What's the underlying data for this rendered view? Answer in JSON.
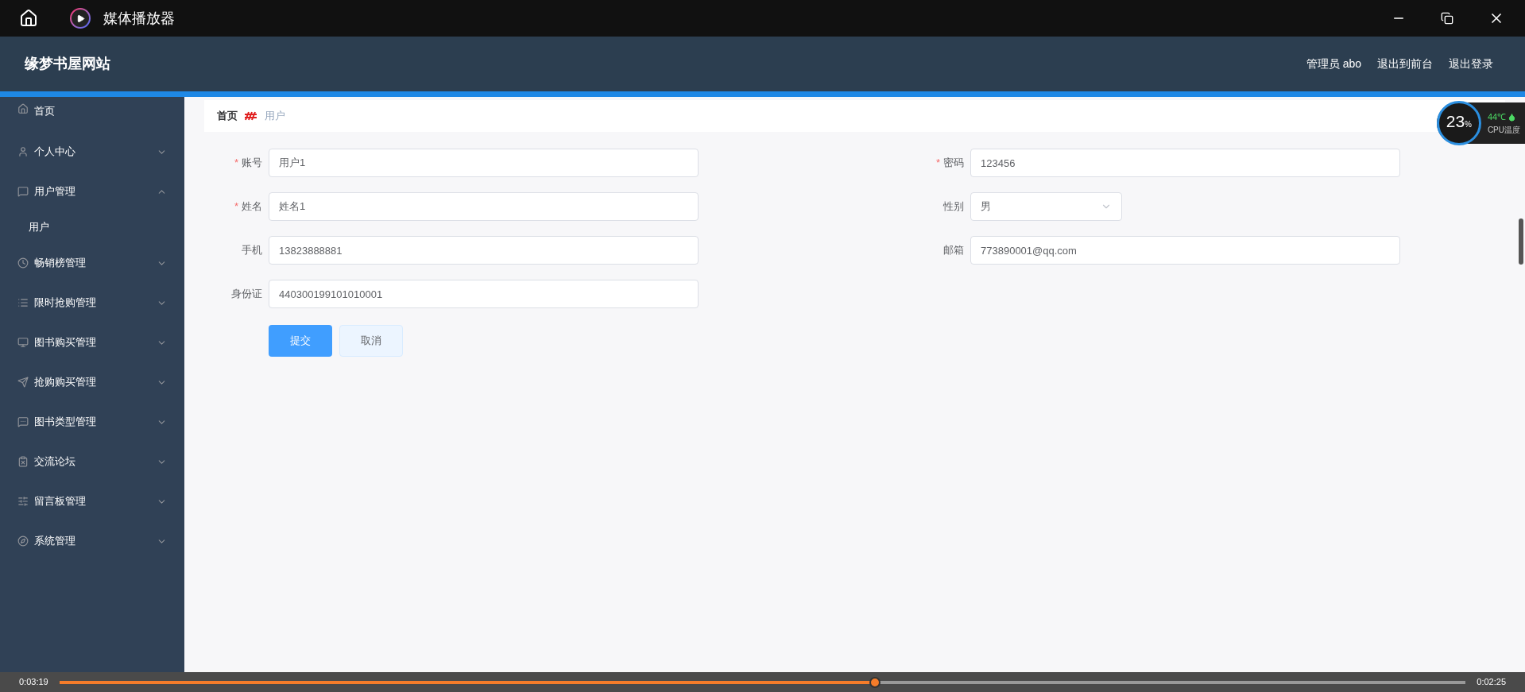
{
  "window": {
    "title": "媒体播放器"
  },
  "header": {
    "site_title": "缘梦书屋网站",
    "user": "管理员 abo",
    "links": [
      "退出到前台",
      "退出登录"
    ]
  },
  "sidebar": {
    "items": [
      {
        "label": "首页",
        "expandable": false
      },
      {
        "label": "个人中心",
        "expandable": true,
        "expanded": false
      },
      {
        "label": "用户管理",
        "expandable": true,
        "expanded": true,
        "children": [
          {
            "label": "用户"
          }
        ]
      },
      {
        "label": "畅销榜管理",
        "expandable": true,
        "expanded": false
      },
      {
        "label": "限时抢购管理",
        "expandable": true,
        "expanded": false
      },
      {
        "label": "图书购买管理",
        "expandable": true,
        "expanded": false
      },
      {
        "label": "抢购购买管理",
        "expandable": true,
        "expanded": false
      },
      {
        "label": "图书类型管理",
        "expandable": true,
        "expanded": false
      },
      {
        "label": "交流论坛",
        "expandable": true,
        "expanded": false
      },
      {
        "label": "留言板管理",
        "expandable": true,
        "expanded": false
      },
      {
        "label": "系统管理",
        "expandable": true,
        "expanded": false
      }
    ]
  },
  "breadcrumb": [
    "首页",
    "用户"
  ],
  "form": {
    "left": [
      {
        "label": "账号",
        "required_mark": "*",
        "kind": "text",
        "value": "用户1"
      },
      {
        "label": "姓名",
        "required_mark": "*",
        "kind": "text",
        "value": "姓名1"
      },
      {
        "label": "手机",
        "kind": "text",
        "value": "13823888881"
      },
      {
        "label": "身份证",
        "kind": "text",
        "value": "440300199101010001"
      }
    ],
    "right": [
      {
        "label": "密码",
        "required_mark": "*",
        "kind": "text",
        "value": "123456"
      },
      {
        "label": "性别",
        "kind": "select",
        "value": "男"
      },
      {
        "label": "邮箱",
        "kind": "text",
        "value": "773890001@qq.com"
      }
    ],
    "buttons": [
      {
        "label": "提交",
        "kind": "primary"
      },
      {
        "label": "取消",
        "kind": "plain"
      }
    ]
  },
  "cpu_widget": {
    "usage": "23",
    "unit": "%",
    "temperature": "44℃",
    "caption": "CPU温度"
  },
  "player": {
    "elapsed": "0:03:19",
    "remaining": "0:02:25",
    "level": 0.58
  }
}
